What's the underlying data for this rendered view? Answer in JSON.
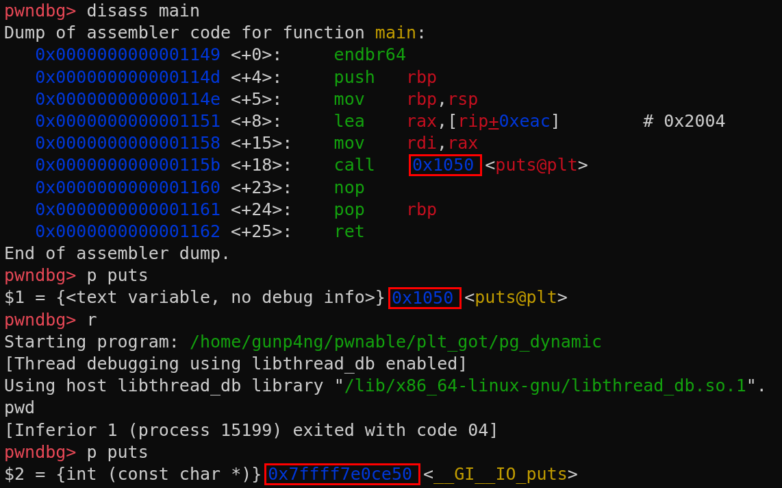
{
  "lines": [
    {
      "kind": "prompt",
      "prompt": "pwndbg>",
      "command": "disass main"
    },
    {
      "kind": "output",
      "segments": [
        {
          "kind": "text",
          "text": "Dump of assembler code for function "
        },
        {
          "kind": "symbol",
          "text": "main"
        },
        {
          "kind": "text",
          "text": ":"
        }
      ]
    },
    {
      "kind": "asm",
      "address": "0x0000000000001149",
      "offset": "<+0>:",
      "mnemonic": "endbr64"
    },
    {
      "kind": "asm",
      "address": "0x000000000000114d",
      "offset": "<+4>:",
      "mnemonic": "push",
      "operands": [
        {
          "kind": "reg",
          "text": "rbp"
        }
      ]
    },
    {
      "kind": "asm",
      "address": "0x000000000000114e",
      "offset": "<+5>:",
      "mnemonic": "mov",
      "operands": [
        {
          "kind": "reg",
          "text": "rbp"
        },
        {
          "kind": "text",
          "text": ","
        },
        {
          "kind": "reg",
          "text": "rsp"
        }
      ]
    },
    {
      "kind": "asm",
      "address": "0x0000000000001151",
      "offset": "<+8>:",
      "mnemonic": "lea",
      "operands": [
        {
          "kind": "reg",
          "text": "rax"
        },
        {
          "kind": "text",
          "text": ",["
        },
        {
          "kind": "reg",
          "text": "rip"
        },
        {
          "kind": "underlined",
          "text": "+"
        },
        {
          "kind": "number",
          "text": "0xeac"
        },
        {
          "kind": "text",
          "text": "]"
        }
      ],
      "comment": "# 0x2004"
    },
    {
      "kind": "asm",
      "address": "0x0000000000001158",
      "offset": "<+15>:",
      "mnemonic": "mov",
      "operands": [
        {
          "kind": "reg",
          "text": "rdi"
        },
        {
          "kind": "text",
          "text": ","
        },
        {
          "kind": "reg",
          "text": "rax"
        }
      ]
    },
    {
      "kind": "asm",
      "address": "0x000000000000115b",
      "offset": "<+18>:",
      "mnemonic": "call",
      "operands": [
        {
          "kind": "boxed",
          "text": "0x1050"
        },
        {
          "kind": "text",
          "text": "<"
        },
        {
          "kind": "reg",
          "text": "puts@plt"
        },
        {
          "kind": "text",
          "text": ">"
        }
      ]
    },
    {
      "kind": "asm",
      "address": "0x0000000000001160",
      "offset": "<+23>:",
      "mnemonic": "nop"
    },
    {
      "kind": "asm",
      "address": "0x0000000000001161",
      "offset": "<+24>:",
      "mnemonic": "pop",
      "operands": [
        {
          "kind": "reg",
          "text": "rbp"
        }
      ]
    },
    {
      "kind": "asm",
      "address": "0x0000000000001162",
      "offset": "<+25>:",
      "mnemonic": "ret"
    },
    {
      "kind": "output",
      "segments": [
        {
          "kind": "text",
          "text": "End of assembler dump."
        }
      ]
    },
    {
      "kind": "prompt",
      "prompt": "pwndbg>",
      "command": "p puts"
    },
    {
      "kind": "output",
      "segments": [
        {
          "kind": "text",
          "text": "$1 = {<text variable, no debug info>}"
        },
        {
          "kind": "boxed",
          "text": "0x1050"
        },
        {
          "kind": "text",
          "text": "<"
        },
        {
          "kind": "symbol",
          "text": "puts@plt"
        },
        {
          "kind": "text",
          "text": ">"
        }
      ]
    },
    {
      "kind": "prompt",
      "prompt": "pwndbg>",
      "command": "r"
    },
    {
      "kind": "output",
      "segments": [
        {
          "kind": "text",
          "text": "Starting program: "
        },
        {
          "kind": "path",
          "text": "/home/gunp4ng/pwnable/plt_got/pg_dynamic"
        }
      ]
    },
    {
      "kind": "output",
      "segments": [
        {
          "kind": "text",
          "text": "[Thread debugging using libthread_db enabled]"
        }
      ]
    },
    {
      "kind": "output",
      "segments": [
        {
          "kind": "text",
          "text": "Using host libthread_db library \""
        },
        {
          "kind": "path",
          "text": "/lib/x86_64-linux-gnu/libthread_db.so.1"
        },
        {
          "kind": "text",
          "text": "\"."
        }
      ]
    },
    {
      "kind": "output",
      "segments": [
        {
          "kind": "text",
          "text": "pwd"
        }
      ]
    },
    {
      "kind": "output",
      "segments": [
        {
          "kind": "text",
          "text": "[Inferior 1 (process 15199) exited with code 04]"
        }
      ]
    },
    {
      "kind": "prompt",
      "prompt": "pwndbg>",
      "command": "p puts"
    },
    {
      "kind": "output",
      "segments": [
        {
          "kind": "text",
          "text": "$2 = {int (const char *)}"
        },
        {
          "kind": "boxed",
          "text": "0x7ffff7e0ce50"
        },
        {
          "kind": "text",
          "text": "<"
        },
        {
          "kind": "symbol",
          "text": "__GI__IO_puts"
        },
        {
          "kind": "text",
          "text": ">"
        }
      ]
    }
  ]
}
